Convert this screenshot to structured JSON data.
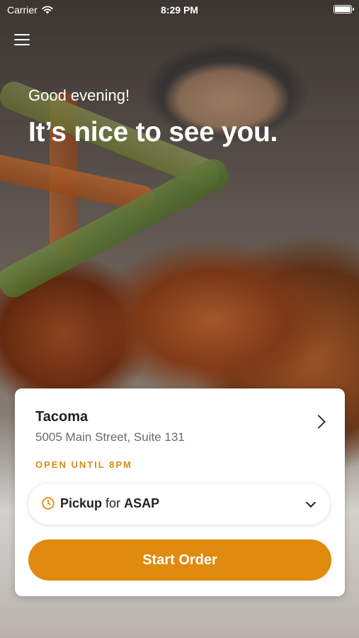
{
  "status_bar": {
    "carrier": "Carrier",
    "time": "8:29 PM",
    "battery_level": 1.0
  },
  "header": {
    "menu_icon": "hamburger-menu-icon"
  },
  "greeting": {
    "salutation": "Good evening!",
    "headline": "It’s nice to see you."
  },
  "location": {
    "name": "Tacoma",
    "address": "5005 Main Street, Suite 131",
    "hours": "OPEN UNTIL 8PM"
  },
  "order_mode": {
    "mode": "Pickup",
    "connector": "for",
    "time": "ASAP"
  },
  "actions": {
    "start_order_label": "Start Order"
  },
  "colors": {
    "accent": "#e08a0e",
    "hours_text": "#d98a14"
  }
}
